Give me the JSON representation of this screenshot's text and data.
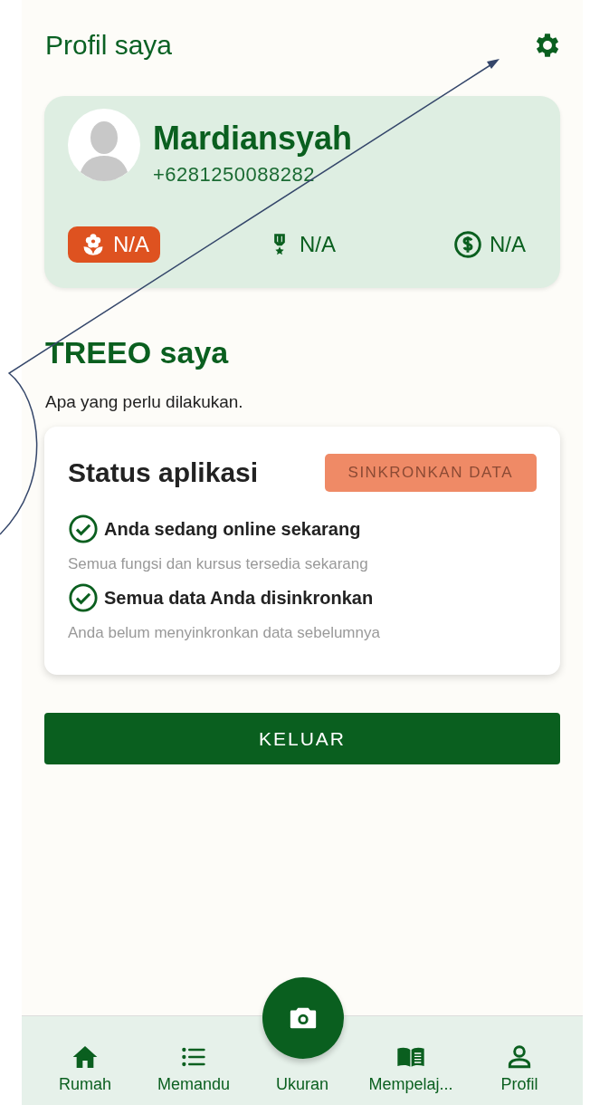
{
  "header": {
    "title": "Profil saya"
  },
  "profile": {
    "name": "Mardiansyah",
    "phone": "+6281250088282",
    "stats": [
      {
        "kind": "plant",
        "value": "N/A",
        "selected": true
      },
      {
        "kind": "medal",
        "value": "N/A",
        "selected": false
      },
      {
        "kind": "money",
        "value": "N/A",
        "selected": false
      }
    ]
  },
  "section": {
    "title": "TREEO saya",
    "subtitle": "Apa yang perlu dilakukan."
  },
  "status_card": {
    "title": "Status aplikasi",
    "sync_button": "SINKRONKAN DATA",
    "items": [
      {
        "label": "Anda sedang online sekarang",
        "detail": "Semua fungsi dan kursus tersedia sekarang",
        "checked": true
      },
      {
        "label": "Semua data Anda disinkronkan",
        "detail": "Anda belum menyinkronkan data sebelumnya",
        "checked": true
      }
    ]
  },
  "logout_button": "KELUAR",
  "bottom_nav": [
    {
      "kind": "home",
      "label": "Rumah"
    },
    {
      "kind": "list",
      "label": "Memandu"
    },
    {
      "kind": "camera",
      "label": "Ukuran"
    },
    {
      "kind": "book",
      "label": "Mempelaj..."
    },
    {
      "kind": "person",
      "label": "Profil"
    }
  ]
}
